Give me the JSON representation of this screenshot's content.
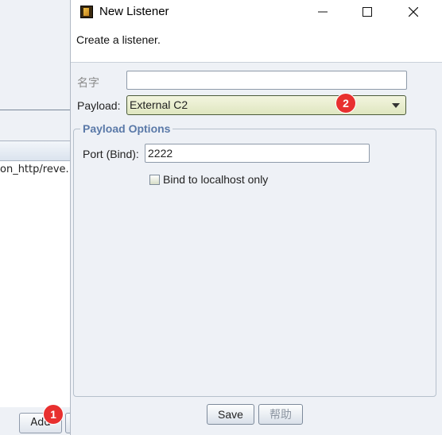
{
  "background": {
    "list_row_text": "on_http/reve...",
    "bottom_buttons": [
      {
        "label": "Add"
      },
      {
        "label": ""
      },
      {
        "label": ""
      },
      {
        "label": ""
      },
      {
        "label": ""
      }
    ]
  },
  "annotations": {
    "badge_1": "1",
    "badge_2": "2",
    "color": "#e8302f"
  },
  "dialog": {
    "title": "New Listener",
    "description": "Create a listener.",
    "name_label": "名字",
    "name_value": "",
    "payload_label": "Payload:",
    "payload_selected": "External C2",
    "group_title": "Payload Options",
    "port_label": "Port (Bind):",
    "port_value": "2222",
    "bind_localhost_label": "Bind to localhost only",
    "bind_localhost_checked": false,
    "save_label": "Save",
    "help_label": "帮助"
  },
  "colors": {
    "group_title": "#5a79a8",
    "combo_selected_bg": "#dfe6c0",
    "window_bg": "#eef1f6"
  },
  "icons": {
    "app": "cobalt-strike-app-icon",
    "minimize": "minimize-icon",
    "maximize": "maximize-icon",
    "close": "close-icon",
    "dropdown": "chevron-down-icon"
  }
}
